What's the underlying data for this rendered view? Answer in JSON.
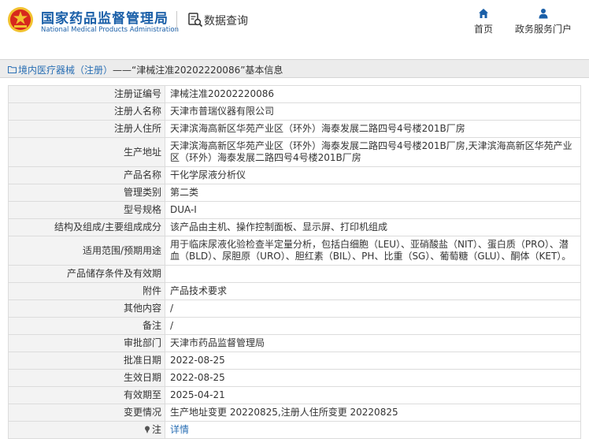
{
  "header": {
    "brand_cn": "国家药品监督管理局",
    "brand_en": "National Medical Products Administration",
    "section_title": "数据查询",
    "nav": [
      {
        "label": "首页",
        "icon": "home-icon"
      },
      {
        "label": "政务服务门户",
        "icon": "user-icon"
      }
    ]
  },
  "breadcrumb": {
    "link": "境内医疗器械（注册）",
    "rest": "——“津械注准20202220086”基本信息"
  },
  "details": [
    {
      "label": "注册证编号",
      "value": "津械注准20202220086"
    },
    {
      "label": "注册人名称",
      "value": "天津市普瑞仪器有限公司"
    },
    {
      "label": "注册人住所",
      "value": "天津滨海高新区华苑产业区（环外）海泰发展二路四号4号楼201B厂房"
    },
    {
      "label": "生产地址",
      "value": "天津滨海高新区华苑产业区（环外）海泰发展二路四号4号楼201B厂房,天津滨海高新区华苑产业区（环外）海泰发展二路四号4号楼201B厂房"
    },
    {
      "label": "产品名称",
      "value": "干化学尿液分析仪"
    },
    {
      "label": "管理类别",
      "value": "第二类"
    },
    {
      "label": "型号规格",
      "value": "DUA-I"
    },
    {
      "label": "结构及组成/主要组成成分",
      "value": "该产品由主机、操作控制面板、显示屏、打印机组成"
    },
    {
      "label": "适用范围/预期用途",
      "value": "用于临床尿液化验检查半定量分析，包括白细胞（LEU）、亚硝酸盐（NIT）、蛋白质（PRO）、潜血（BLD）、尿胆原（URO）、胆红素（BIL）、PH、比重（SG）、葡萄糖（GLU）、酮体（KET）。"
    },
    {
      "label": "产品储存条件及有效期",
      "value": ""
    },
    {
      "label": "附件",
      "value": "产品技术要求"
    },
    {
      "label": "其他内容",
      "value": "/"
    },
    {
      "label": "备注",
      "value": "/"
    },
    {
      "label": "审批部门",
      "value": "天津市药品监督管理局"
    },
    {
      "label": "批准日期",
      "value": "2022-08-25"
    },
    {
      "label": "生效日期",
      "value": "2022-08-25"
    },
    {
      "label": "有效期至",
      "value": "2025-04-21"
    },
    {
      "label": "变更情况",
      "value": "生产地址变更 20220825,注册人住所变更 20220825"
    }
  ],
  "note": {
    "label": "注",
    "link": "详情"
  },
  "colors": {
    "brand_blue": "#1a5fa8",
    "link_blue": "#2a6fb4",
    "logo_red": "#d7281d",
    "logo_gold": "#f2c230"
  }
}
